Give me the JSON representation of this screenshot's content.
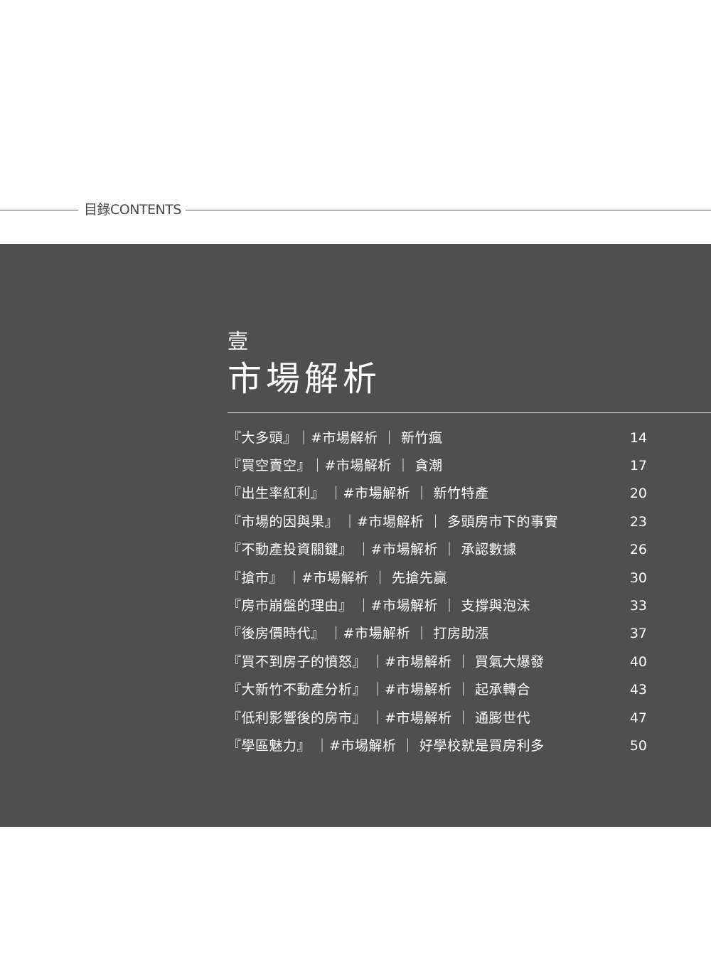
{
  "header": {
    "label": "目錄CONTENTS"
  },
  "chapter": {
    "number": "壹",
    "title": "市場解析"
  },
  "toc": [
    {
      "text": "『大多頭』｜#市場解析 ｜ 新竹瘋",
      "page": "14"
    },
    {
      "text": "『買空賣空』｜#市場解析 ｜ 貪潮",
      "page": "17"
    },
    {
      "text": "『出生率紅利』 ｜#市場解析 ｜ 新竹特產",
      "page": "20"
    },
    {
      "text": "『市場的因與果』 ｜#市場解析 ｜ 多頭房市下的事實",
      "page": "23"
    },
    {
      "text": "『不動產投資關鍵』 ｜#市場解析 ｜ 承認數據",
      "page": "26"
    },
    {
      "text": "『搶市』 ｜#市場解析 ｜ 先搶先贏",
      "page": "30"
    },
    {
      "text": "『房市崩盤的理由』 ｜#市場解析 ｜ 支撐與泡沫",
      "page": "33"
    },
    {
      "text": "『後房價時代』 ｜#市場解析 ｜ 打房助漲",
      "page": "37"
    },
    {
      "text": "『買不到房子的憤怒』 ｜#市場解析 ｜ 買氣大爆發",
      "page": "40"
    },
    {
      "text": "『大新竹不動產分析』 ｜#市場解析 ｜ 起承轉合",
      "page": "43"
    },
    {
      "text": "『低利影響後的房市』 ｜#市場解析 ｜ 通膨世代",
      "page": "47"
    },
    {
      "text": "『學區魅力』 ｜#市場解析 ｜ 好學校就是買房利多",
      "page": "50"
    }
  ]
}
